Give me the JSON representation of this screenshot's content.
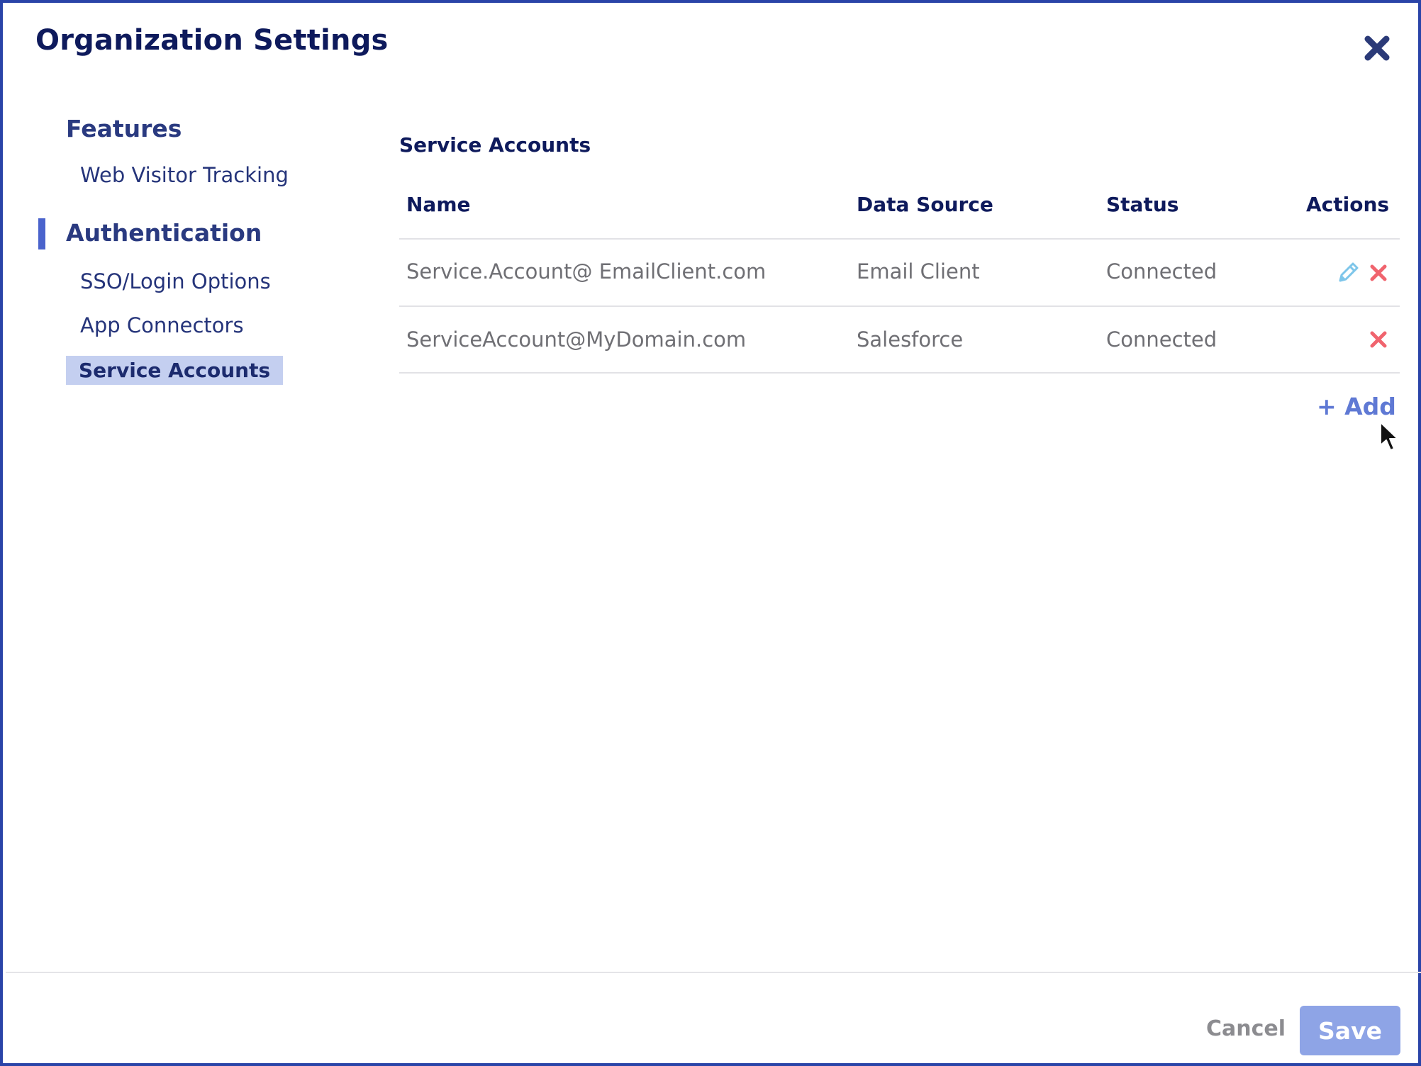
{
  "dialog": {
    "title": "Organization Settings"
  },
  "sidebar": {
    "groups": [
      {
        "label": "Features",
        "items": [
          {
            "label": "Web Visitor Tracking"
          }
        ]
      },
      {
        "label": "Authentication",
        "items": [
          {
            "label": "SSO/Login Options"
          },
          {
            "label": "App Connectors"
          },
          {
            "label": "Service Accounts",
            "active": true
          }
        ]
      }
    ]
  },
  "main": {
    "section_title": "Service Accounts",
    "columns": [
      "Name",
      "Data Source",
      "Status",
      "Actions"
    ],
    "rows": [
      {
        "name": "Service.Account@ EmailClient.com",
        "data_source": "Email Client",
        "status": "Connected",
        "actions": [
          "edit",
          "delete"
        ]
      },
      {
        "name": "ServiceAccount@MyDomain.com",
        "data_source": "Salesforce",
        "status": "Connected",
        "actions": [
          "delete"
        ]
      }
    ],
    "add_label": "+ Add"
  },
  "footer": {
    "cancel_label": "Cancel",
    "save_label": "Save"
  },
  "colors": {
    "border": "#2a44a8",
    "title": "#0e1a5c",
    "active_bg": "#c4cff0",
    "accent": "#4a63cc",
    "delete": "#f0646e",
    "edit": "#7ec6ea",
    "save_bg": "#8ea4e6"
  },
  "icons": {
    "close": "close-icon",
    "edit": "pencil-icon",
    "delete": "x-icon",
    "cursor": "mouse-pointer-icon"
  }
}
